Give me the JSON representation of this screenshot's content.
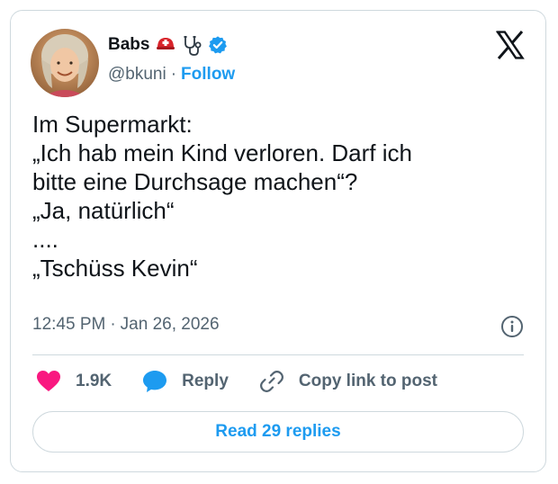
{
  "author": {
    "name": "Babs",
    "handle": "@bkuni",
    "separator": "·",
    "follow_label": "Follow"
  },
  "tweet": {
    "lines": [
      "Im Supermarkt:",
      "„Ich hab mein Kind verloren. Darf ich",
      "bitte eine Durchsage machen“?",
      "„Ja, natürlich“",
      "....",
      "„Tschüss Kevin“"
    ],
    "time": "12:45 PM",
    "date_separator": "·",
    "date": "Jan 26, 2026"
  },
  "actions": {
    "like_count": "1.9K",
    "reply_label": "Reply",
    "copy_label": "Copy link to post"
  },
  "read_replies_label": "Read 29 replies",
  "colors": {
    "accent": "#1d9bf0",
    "like": "#f91880",
    "text": "#0f1419",
    "secondary": "#536471",
    "border": "#cfd9de"
  },
  "icons": {
    "helmet": "rescue-helmet-icon",
    "stethoscope": "stethoscope-icon",
    "verified": "verified-badge-icon",
    "logo": "x-logo-icon",
    "info": "info-icon",
    "like": "heart-icon",
    "reply": "speech-bubble-icon",
    "copy": "link-icon"
  }
}
